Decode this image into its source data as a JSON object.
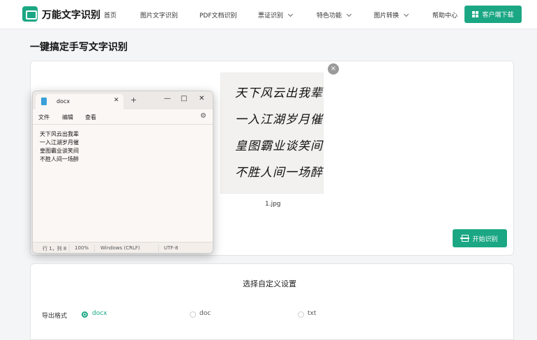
{
  "header": {
    "logo_text": "万能文字识别",
    "nav": [
      "首页",
      "图片文字识别",
      "PDF文档识别",
      "票证识别",
      "特色功能",
      "图片转换",
      "帮助中心"
    ],
    "download_label": "客户端下载",
    "accent": "#1ba784"
  },
  "page": {
    "title": "一键搞定手写文字识别"
  },
  "upload": {
    "file_name": "1.jpg",
    "handwritten_lines": [
      "天下风云出我辈",
      "一入江湖岁月催",
      "皇图霸业谈笑间",
      "不胜人间一场醉"
    ],
    "start_label": "开始识别",
    "close_glyph": "×"
  },
  "notepad": {
    "tab_title": "docx",
    "menu": [
      "文件",
      "编辑",
      "查看"
    ],
    "lines": [
      "天下风云出我辈",
      "一入江湖岁月催",
      "皇图霸业谈笑间",
      "不胜人间一场醉"
    ],
    "status": {
      "position": "行 1，列 8",
      "zoom": "100%",
      "line_ending": "Windows (CRLF)",
      "encoding": "UTF-8"
    }
  },
  "settings": {
    "title": "选择自定义设置",
    "format_label": "导出格式",
    "options": [
      "docx",
      "doc",
      "txt"
    ],
    "selected": "docx"
  }
}
